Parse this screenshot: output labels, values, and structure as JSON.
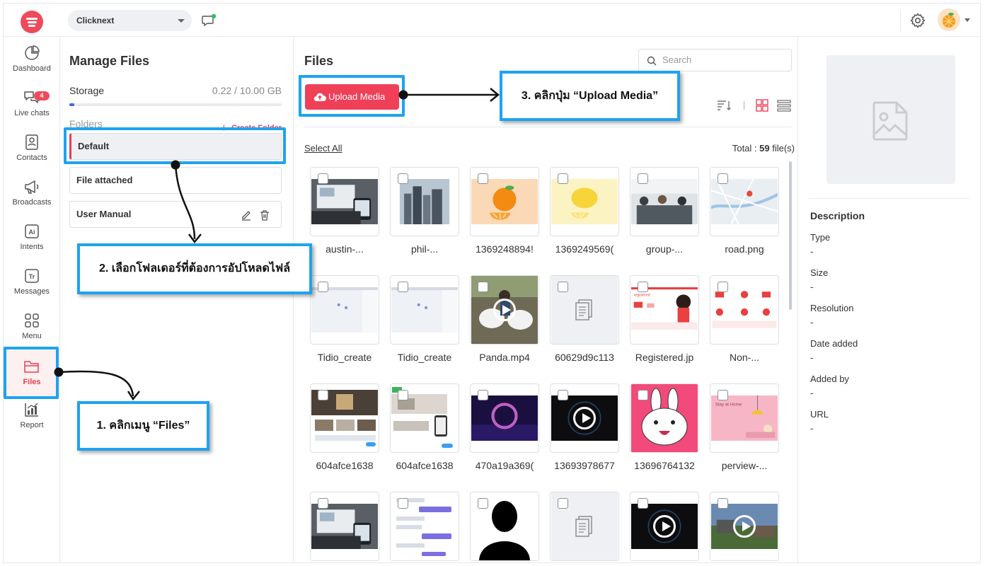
{
  "topbar": {
    "workspace": "Clicknext"
  },
  "nav": {
    "items": [
      {
        "label": "Dashboard",
        "icon": "pie-chart-icon"
      },
      {
        "label": "Live chats",
        "icon": "chat-bubbles-icon",
        "badge": "4"
      },
      {
        "label": "Contacts",
        "icon": "contact-book-icon"
      },
      {
        "label": "Broadcasts",
        "icon": "megaphone-icon"
      },
      {
        "label": "Intents",
        "icon": "ai-icon"
      },
      {
        "label": "Messages",
        "icon": "text-message-icon"
      },
      {
        "label": "Menu",
        "icon": "grid-menu-icon"
      },
      {
        "label": "Files",
        "icon": "folder-icon"
      },
      {
        "label": "Report",
        "icon": "bar-chart-icon"
      }
    ],
    "active": "Files"
  },
  "manage": {
    "title": "Manage Files",
    "storage_label": "Storage",
    "storage_value": "0.22 / 10.00 GB",
    "storage_used_fraction": 0.022,
    "folders_label": "Folders",
    "create_folder": "Create Folder",
    "folders": [
      "Default",
      "File attached",
      "User Manual"
    ],
    "active_folder": "Default"
  },
  "files": {
    "title": "Files",
    "search_placeholder": "Search",
    "upload_label": "Upload Media",
    "select_all": "Select All",
    "total_prefix": "Total : ",
    "total_count": "59",
    "total_suffix": " file(s)",
    "items": [
      {
        "name": "austin-...",
        "thumb": "laptop"
      },
      {
        "name": "phil-...",
        "thumb": "city"
      },
      {
        "name": "1369248894!",
        "thumb": "orange"
      },
      {
        "name": "1369249569(",
        "thumb": "lemon"
      },
      {
        "name": "group-...",
        "thumb": "office"
      },
      {
        "name": "road.png",
        "thumb": "map"
      },
      {
        "name": "Tidio_create",
        "thumb": "screen"
      },
      {
        "name": "Tidio_create",
        "thumb": "screen"
      },
      {
        "name": "Panda.mp4",
        "thumb": "panda-video"
      },
      {
        "name": "60629d9c113",
        "thumb": "document"
      },
      {
        "name": "Registered.jp",
        "thumb": "registered"
      },
      {
        "name": "Non-...",
        "thumb": "nonreg"
      },
      {
        "name": "604afce1638",
        "thumb": "website"
      },
      {
        "name": "604afce1638",
        "thumb": "website2"
      },
      {
        "name": "470a19a369(",
        "thumb": "neon"
      },
      {
        "name": "13693978677",
        "thumb": "video"
      },
      {
        "name": "13696764132",
        "thumb": "bunny"
      },
      {
        "name": "perview-...",
        "thumb": "pink"
      },
      {
        "name": "",
        "thumb": "laptop"
      },
      {
        "name": "",
        "thumb": "chatlog"
      },
      {
        "name": "",
        "thumb": "person"
      },
      {
        "name": "",
        "thumb": "document"
      },
      {
        "name": "",
        "thumb": "video"
      },
      {
        "name": "",
        "thumb": "landscape-video"
      }
    ]
  },
  "details": {
    "title": "Description",
    "fields": [
      {
        "label": "Type",
        "value": "-"
      },
      {
        "label": "Size",
        "value": "-"
      },
      {
        "label": "Resolution",
        "value": "-"
      },
      {
        "label": "Date added",
        "value": "-"
      },
      {
        "label": "Added by",
        "value": "-"
      },
      {
        "label": "URL",
        "value": "-"
      }
    ]
  },
  "annotations": {
    "step1": "1. คลิกเมนู “Files”",
    "step2": "2. เลือกโฟลเดอร์ที่ต้องการอัปโหลดไฟล์",
    "step3": "3. คลิกปุ่ม “Upload Media”"
  },
  "colors": {
    "accent": "#ef4058",
    "annotation": "#1ea3f0"
  }
}
